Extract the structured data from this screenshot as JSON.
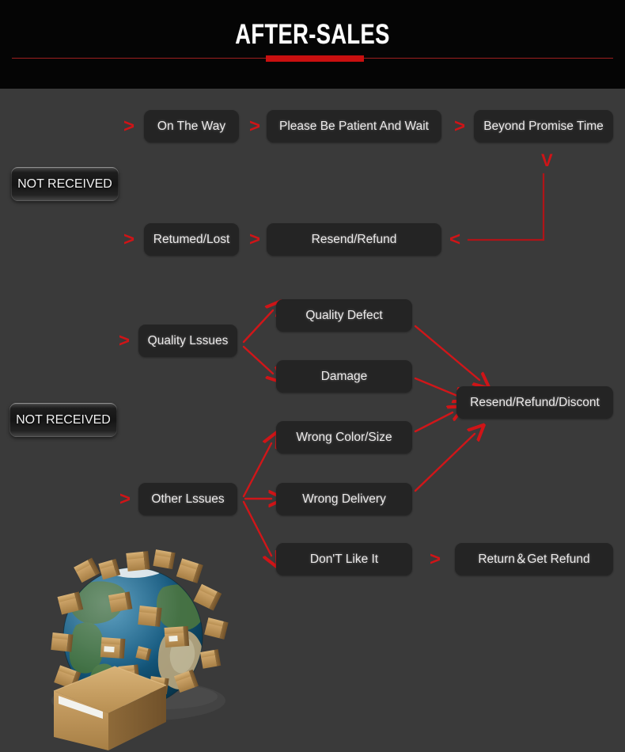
{
  "header": {
    "title": "AFTER-SALES",
    "rule_color": "#9e1f1f",
    "accent_color": "#c90f0f",
    "background": "#050505"
  },
  "colors": {
    "page_background": "#3a3a3a",
    "node_background": "#242424",
    "node_text": "#eceaea",
    "arrow_red": "#cf1417",
    "accent_red": "#c90f0f"
  },
  "groups": [
    {
      "label": "NOT RECEIVED",
      "name": "not-received-1"
    },
    {
      "label": "NOT RECEIVED",
      "name": "not-received-2"
    }
  ],
  "nodes": {
    "on_the_way": "On The Way",
    "please_wait": "Please Be Patient And Wait",
    "beyond_promise_time": "Beyond Promise Time",
    "returned_lost": "Retumed/Lost",
    "resend_refund": "Resend/Refund",
    "quality_issues": "Quality Lssues",
    "quality_defect": "Quality Defect",
    "damage": "Damage",
    "resend_refund_discount": "Resend/Refund/Discont",
    "other_issues": "Other Lssues",
    "wrong_color_size": "Wrong Color/Size",
    "wrong_delivery": "Wrong Delivery",
    "dont_like_it": "Don'T Like It",
    "return_get_refund": "Return＆Get Refund"
  },
  "chevrons": {
    "right": ">",
    "left": "<",
    "down": "V"
  },
  "artwork": {
    "name": "globe-with-parcels-illustration",
    "description": "Earth globe covered in cardboard shipping boxes with a large cardboard parcel in front"
  }
}
